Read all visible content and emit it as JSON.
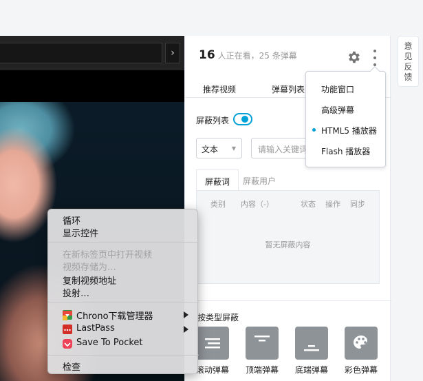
{
  "panel": {
    "viewer_count": "16",
    "viewer_text": "人正在看，25 条弹幕",
    "tabs": [
      "推荐视频",
      "弹幕列表"
    ],
    "block_list_label": "屏蔽列表",
    "block_list_enabled": true,
    "type_select_value": "文本",
    "keyword_placeholder": "请输入关键词",
    "subtabs": [
      "屏蔽词",
      "屏蔽用户"
    ],
    "table_headers": [
      "类别",
      "内容（-）",
      "状态",
      "操作",
      "同步"
    ],
    "empty_text": "暂无屏蔽内容",
    "type_block_label": "按类型屏蔽",
    "type_buttons": [
      "滚动弹幕",
      "顶端弹幕",
      "底端弹幕",
      "彩色弹幕"
    ]
  },
  "menu": {
    "items": [
      "功能窗口",
      "高级弹幕",
      "HTML5 播放器",
      "Flash 播放器"
    ],
    "selected": "HTML5 播放器"
  },
  "feedback": {
    "label": "意见反馈"
  },
  "context_menu": {
    "items": [
      "循环",
      "显示控件"
    ],
    "disabled_items": [
      "在新标签页中打开视频",
      "视频存储为…"
    ],
    "items2": [
      "复制视频地址",
      "投射…"
    ],
    "extensions": [
      "Chrono下载管理器",
      "LastPass",
      "Save To Pocket"
    ],
    "inspect": "检查"
  },
  "colors": {
    "accent": "#00a1d6",
    "pocket": "#ee4056",
    "lastpass": "#d32d27"
  }
}
